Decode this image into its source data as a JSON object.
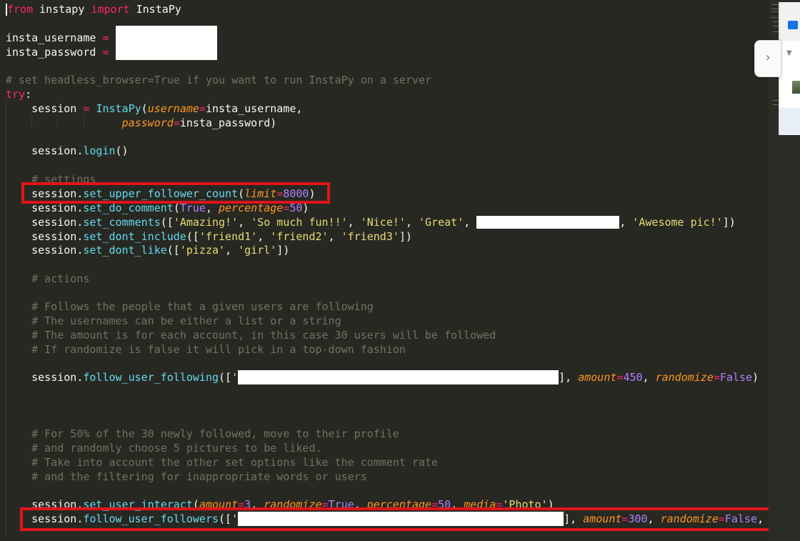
{
  "code": {
    "l1": {
      "kw1": "from",
      "mod": " instapy ",
      "kw2": "import",
      "cls": " InstaPy"
    },
    "l2": {
      "var": "insta_username ",
      "op": "="
    },
    "l3": {
      "var": "insta_password ",
      "op": "="
    },
    "l4": {
      "comment": "# set headless_browser=True if you want to run InstaPy on a server"
    },
    "l5": {
      "kw": "try",
      "colon": ":"
    },
    "l6": {
      "a": "    session ",
      "op": "=",
      "sp": " ",
      "fn": "InstaPy",
      "p1": "(",
      "arg": "username",
      "eq": "=",
      "val": "insta_username,"
    },
    "l7": {
      "pad": "                  ",
      "arg": "password",
      "eq": "=",
      "val": "insta_password)"
    },
    "l8": {
      "a": "    session.",
      "fn": "login",
      "b": "()"
    },
    "l9": {
      "comment": "    # settings"
    },
    "l10": {
      "a": "    session.",
      "fn": "set_upper_follower_count",
      "p": "(",
      "arg": "limit",
      "eq": "=",
      "num": "8000",
      "close": ")"
    },
    "l11": {
      "a": "    session.",
      "fn": "set_do_comment",
      "p": "(",
      "num1": "True",
      "c": ", ",
      "arg": "percentage",
      "eq": "=",
      "num2": "50",
      "close": ")"
    },
    "l12": {
      "a": "    session.",
      "fn": "set_comments",
      "p": "([",
      "s1": "'Amazing!'",
      "c1": ", ",
      "s2": "'So much fun!!'",
      "c2": ", ",
      "s3": "'Nice!'",
      "c3": ", ",
      "s4": "'Great'",
      "c4": ", ",
      "c5": ", ",
      "s5": "'Awesome pic!'",
      "close": "])"
    },
    "l13": {
      "a": "    session.",
      "fn": "set_dont_include",
      "p": "([",
      "s1": "'friend1'",
      "c1": ", ",
      "s2": "'friend2'",
      "c2": ", ",
      "s3": "'friend3'",
      "close": "])"
    },
    "l14": {
      "a": "    session.",
      "fn": "set_dont_like",
      "p": "([",
      "s1": "'pizza'",
      "c1": ", ",
      "s2": "'girl'",
      "close": "])"
    },
    "l15": {
      "comment": "    # actions"
    },
    "l16": {
      "comment": "    # Follows the people that a given users are following"
    },
    "l17": {
      "comment": "    # The usernames can be either a list or a string"
    },
    "l18": {
      "comment": "    # The amount is for each account, in this case 30 users will be followed"
    },
    "l19": {
      "comment": "    # If randomize is false it will pick in a top-down fashion"
    },
    "l20": {
      "a": "    session.",
      "fn": "follow_user_following",
      "p": "([",
      "q": "'",
      "after": "], ",
      "arg1": "amount",
      "eq1": "=",
      "num1": "450",
      "c": ", ",
      "arg2": "randomize",
      "eq2": "=",
      "num2": "False",
      "tail": ")"
    },
    "l21": {
      "comment": "    # For 50% of the 30 newly followed, move to their profile"
    },
    "l22": {
      "comment": "    # and randomly choose 5 pictures to be liked."
    },
    "l23": {
      "comment": "    # Take into account the other set options like the comment rate"
    },
    "l24": {
      "comment": "    # and the filtering for inappropriate words or users"
    },
    "l25": {
      "a": "    session.",
      "fn": "set_user_interact",
      "p": "(",
      "arg1": "amount",
      "eq1": "=",
      "num1": "3",
      "c1": ", ",
      "arg2": "randomize",
      "eq2": "=",
      "num2": "True",
      "c2": ", ",
      "arg3": "percentage",
      "eq3": "=",
      "num3": "50",
      "c3": ", ",
      "arg4": "media",
      "eq4": "=",
      "str": "'Photo'",
      "close": ")"
    },
    "l26": {
      "a": "    session.",
      "fn": "follow_user_followers",
      "p": "([",
      "q": "'",
      "after": "], ",
      "arg1": "amount",
      "eq1": "=",
      "num1": "300",
      "c": ", ",
      "arg2": "randomize",
      "eq2": "=",
      "num2": "False",
      "tail": ","
    }
  },
  "side_panel": {
    "collapse_glyph": "›",
    "expand_glyph": "▼"
  },
  "colors": {
    "keyword": "#f92672",
    "function": "#66d9ef",
    "argument": "#fd971f",
    "number": "#ae81ff",
    "string": "#e6db74",
    "comment": "#75715e",
    "highlight_box": "#e0141b"
  }
}
